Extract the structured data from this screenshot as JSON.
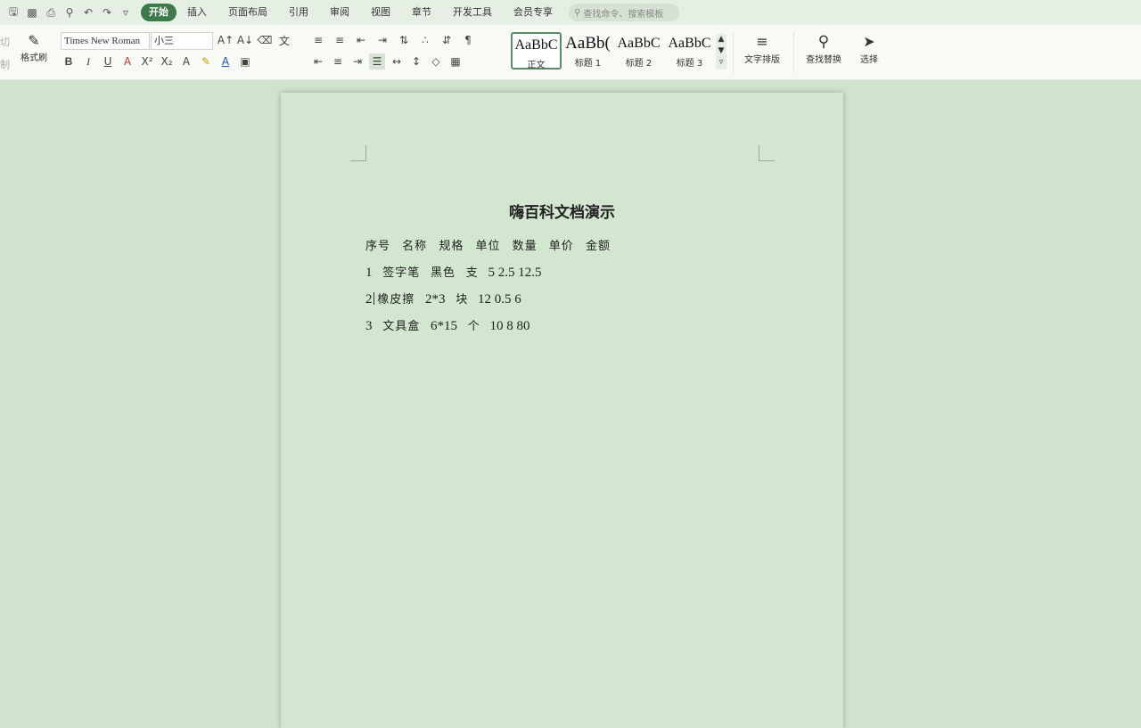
{
  "tabbar": {
    "tabs": [
      "开始",
      "插入",
      "页面布局",
      "引用",
      "审阅",
      "视图",
      "章节",
      "开发工具",
      "会员专享"
    ],
    "active_tab": "开始",
    "search_placeholder": "查找命令、搜索模板"
  },
  "ribbon": {
    "clipboard": {
      "cut_label": "切",
      "copy_label": "制",
      "format_painter_label": "格式刷"
    },
    "font": {
      "name": "Times New Roman",
      "size": "小三"
    },
    "styles": [
      {
        "sample": "AaBbC",
        "name": "正文"
      },
      {
        "sample": "AaBb(",
        "name": "标题 1"
      },
      {
        "sample": "AaBbC",
        "name": "标题 2"
      },
      {
        "sample": "AaBbC",
        "name": "标题 3"
      }
    ],
    "text_layout_label": "文字排版",
    "find_replace_label": "查找替换",
    "select_label": "选择"
  },
  "document": {
    "title": "嗨百科文档演示",
    "header_cells": [
      "序号",
      "名称",
      "规格",
      "单位",
      "数量",
      "单价",
      "金额"
    ],
    "rows": [
      [
        "1",
        "签字笔",
        "黑色",
        "支",
        "5 2.5 12.5"
      ],
      [
        "2",
        "橡皮擦",
        "2*3",
        "块",
        "12 0.5 6"
      ],
      [
        "3",
        "文具盒",
        "6*15",
        "个",
        "10 8 80"
      ]
    ]
  }
}
